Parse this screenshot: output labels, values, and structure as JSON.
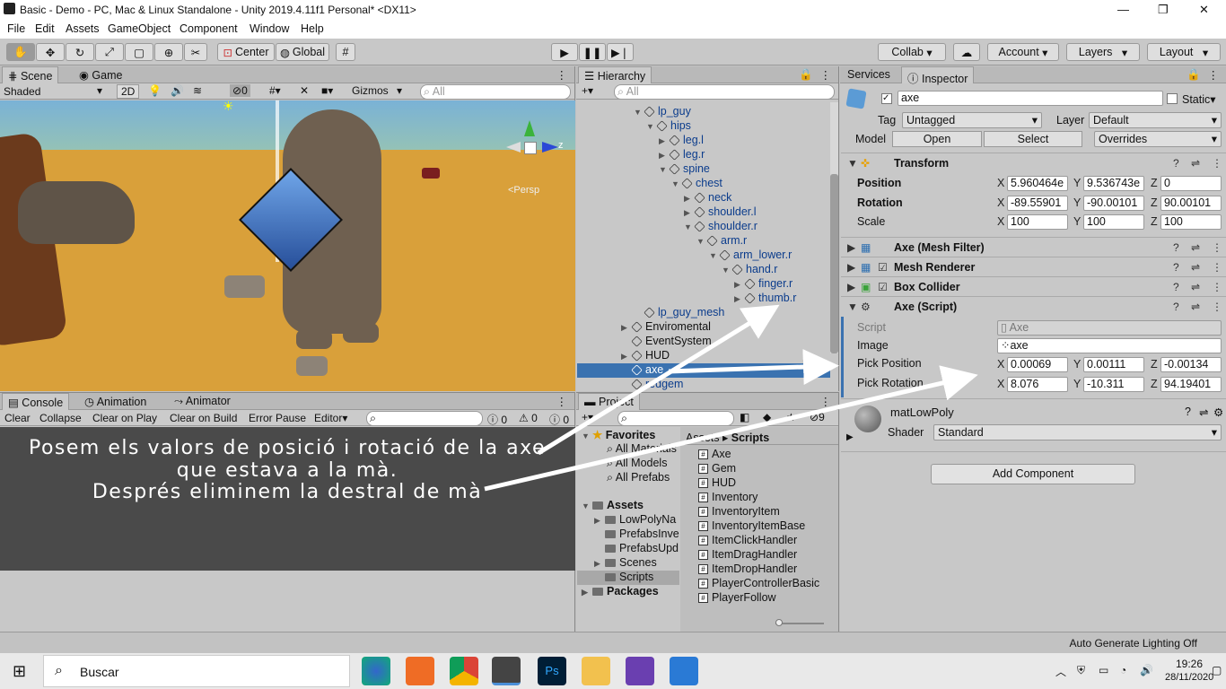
{
  "window": {
    "title": "Basic - Demo - PC, Mac & Linux Standalone - Unity 2019.4.11f1 Personal* <DX11>",
    "minimize": "—",
    "maximize": "❐",
    "close": "✕"
  },
  "menu": [
    "File",
    "Edit",
    "Assets",
    "GameObject",
    "Component",
    "Window",
    "Help"
  ],
  "toolbar": {
    "center": "Center",
    "global": "Global",
    "collab": "Collab",
    "account": "Account",
    "layers": "Layers",
    "layout": "Layout"
  },
  "scene": {
    "tab_scene": "Scene",
    "tab_game": "Game",
    "shading": "Shaded",
    "mode_2d": "2D",
    "hidden_count": "0",
    "gizmos": "Gizmos",
    "search_placeholder": "All",
    "persp": "<Persp",
    "axis_z": "z"
  },
  "hierarchy": {
    "tab": "Hierarchy",
    "search_placeholder": "All",
    "items": [
      {
        "label": "lp_guy"
      },
      {
        "label": "hips"
      },
      {
        "label": "leg.l"
      },
      {
        "label": "leg.r"
      },
      {
        "label": "spine"
      },
      {
        "label": "chest"
      },
      {
        "label": "neck"
      },
      {
        "label": "shoulder.l"
      },
      {
        "label": "shoulder.r"
      },
      {
        "label": "arm.r"
      },
      {
        "label": "arm_lower.r"
      },
      {
        "label": "hand.r"
      },
      {
        "label": "finger.r"
      },
      {
        "label": "thumb.r"
      },
      {
        "label": "lp_guy_mesh"
      },
      {
        "label": "Enviromental"
      },
      {
        "label": "EventSystem"
      },
      {
        "label": "HUD"
      },
      {
        "label": "axe"
      },
      {
        "label": "redgem"
      }
    ]
  },
  "inspector": {
    "tab_services": "Services",
    "tab_inspector": "Inspector",
    "object_name": "axe",
    "static_label": "Static",
    "tag_label": "Tag",
    "tag_value": "Untagged",
    "layer_label": "Layer",
    "layer_value": "Default",
    "model_label": "Model",
    "open_btn": "Open",
    "select_btn": "Select",
    "overrides": "Overrides",
    "transform": {
      "title": "Transform",
      "position_label": "Position",
      "pos_x": "5.960464e",
      "pos_y": "9.536743e",
      "pos_z": "0",
      "rotation_label": "Rotation",
      "rot_x": "-89.55901",
      "rot_y": "-90.00101",
      "rot_z": "90.00101",
      "scale_label": "Scale",
      "scale_x": "100",
      "scale_y": "100",
      "scale_z": "100"
    },
    "mesh_filter": "Axe (Mesh Filter)",
    "mesh_renderer": "Mesh Renderer",
    "box_collider": "Box Collider",
    "script_comp": {
      "title": "Axe (Script)",
      "script_label": "Script",
      "script_value": "Axe",
      "image_label": "Image",
      "image_value": "axe",
      "pick_pos_label": "Pick Position",
      "pp_x": "0.00069",
      "pp_y": "0.00111",
      "pp_z": "-0.00134",
      "pick_rot_label": "Pick Rotation",
      "pr_x": "8.076",
      "pr_y": "-10.311",
      "pr_z": "94.19401"
    },
    "material": "matLowPoly",
    "shader_label": "Shader",
    "shader_value": "Standard",
    "add_component": "Add Component",
    "x": "X",
    "y": "Y",
    "z": "Z"
  },
  "console": {
    "tab_console": "Console",
    "tab_animation": "Animation",
    "tab_animator": "Animator",
    "clear": "Clear",
    "collapse": "Collapse",
    "clear_on_play": "Clear on Play",
    "clear_on_build": "Clear on Build",
    "error_pause": "Error Pause",
    "editor": "Editor",
    "count_log": "0",
    "count_warn": "0",
    "count_err": "0"
  },
  "project": {
    "tab": "Project",
    "badge": "9",
    "favorites": "Favorites",
    "all_materials": "All Materials",
    "all_models": "All Models",
    "all_prefabs": "All Prefabs",
    "assets": "Assets",
    "folders": [
      "LowPolyNa",
      "PrefabsInve",
      "PrefabsUpd",
      "Scenes",
      "Scripts"
    ],
    "packages": "Packages",
    "breadcrumb_root": "Assets",
    "breadcrumb_sep": "▸",
    "breadcrumb_current": "Scripts",
    "scripts": [
      "Axe",
      "Gem",
      "HUD",
      "Inventory",
      "InventoryItem",
      "InventoryItemBase",
      "ItemClickHandler",
      "ItemDragHandler",
      "ItemDropHandler",
      "PlayerControllerBasic",
      "PlayerFollow"
    ]
  },
  "annotation": {
    "line1": "Posem els valors de posició i rotació de la axe",
    "line2": "que estava a la mà.",
    "line3": "Després eliminem la destral de mà"
  },
  "status": {
    "lighting": "Auto Generate Lighting Off"
  },
  "taskbar": {
    "search": "Buscar",
    "time": "19:26",
    "date": "28/11/2020"
  }
}
